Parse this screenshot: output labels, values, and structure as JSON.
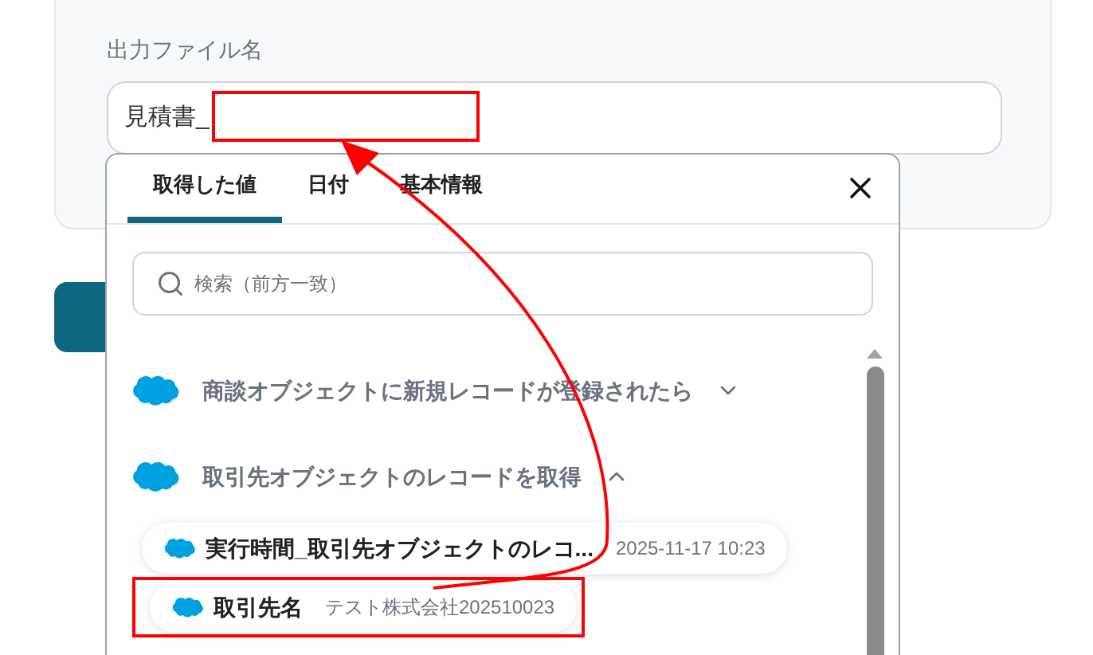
{
  "field": {
    "label": "出力ファイル名",
    "value": "見積書_"
  },
  "popup": {
    "tabs": [
      {
        "label": "取得した値",
        "selected": true
      },
      {
        "label": "日付",
        "selected": false
      },
      {
        "label": "基本情報",
        "selected": false
      }
    ],
    "search": {
      "placeholder": "検索（前方一致）"
    },
    "sections": [
      {
        "title": "商談オブジェクトに新規レコードが登録されたら",
        "expanded": false
      },
      {
        "title": "取引先オブジェクトのレコードを取得",
        "expanded": true,
        "items": [
          {
            "name": "実行時間_取引先オブジェクトのレコ...",
            "value": "2025-11-17 10:23",
            "highlighted": false
          },
          {
            "name": "取引先名",
            "value": "テスト株式会社202510023",
            "highlighted": true
          }
        ]
      }
    ]
  }
}
